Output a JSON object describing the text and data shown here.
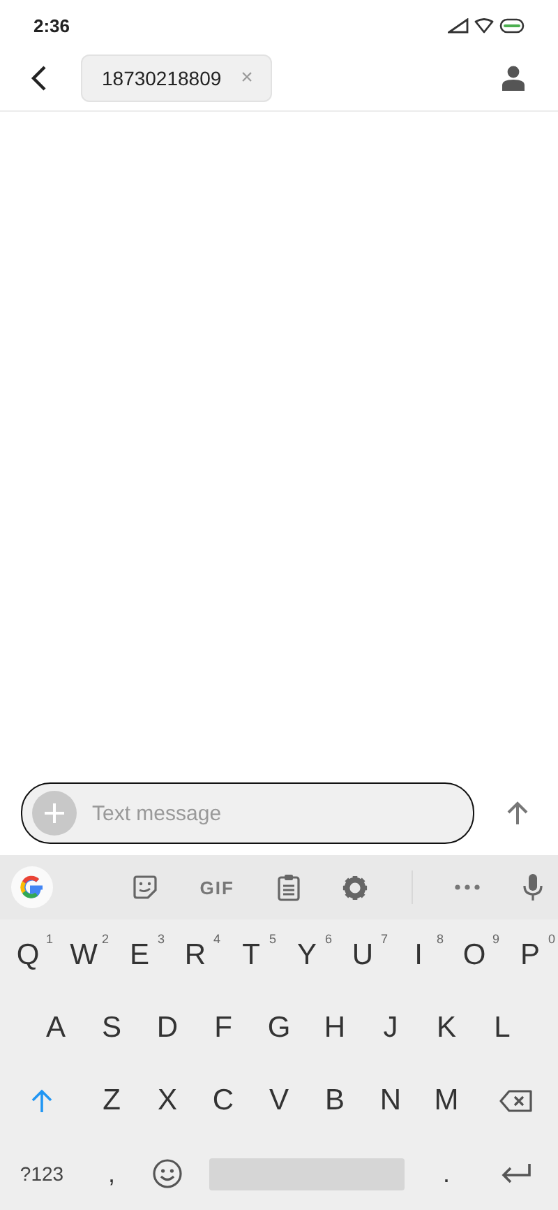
{
  "status_bar": {
    "time": "2:36"
  },
  "header": {
    "recipient": "18730218809",
    "remove": "×"
  },
  "composer": {
    "placeholder": "Text message"
  },
  "keyboard": {
    "toolbar": [
      {
        "kind": "google"
      },
      {
        "kind": "sticker"
      },
      {
        "kind": "gif",
        "label": "GIF"
      },
      {
        "kind": "clipboard"
      },
      {
        "kind": "settings"
      },
      {
        "kind": "more"
      },
      {
        "kind": "mic"
      }
    ],
    "rows": [
      {
        "keys": [
          {
            "kind": "letter",
            "label": "Q",
            "hint": "1"
          },
          {
            "kind": "letter",
            "label": "W",
            "hint": "2"
          },
          {
            "kind": "letter",
            "label": "E",
            "hint": "3"
          },
          {
            "kind": "letter",
            "label": "R",
            "hint": "4"
          },
          {
            "kind": "letter",
            "label": "T",
            "hint": "5"
          },
          {
            "kind": "letter",
            "label": "Y",
            "hint": "6"
          },
          {
            "kind": "letter",
            "label": "U",
            "hint": "7"
          },
          {
            "kind": "letter",
            "label": "I",
            "hint": "8"
          },
          {
            "kind": "letter",
            "label": "O",
            "hint": "9"
          },
          {
            "kind": "letter",
            "label": "P",
            "hint": "0"
          }
        ]
      },
      {
        "keys": [
          {
            "kind": "letter",
            "label": "A"
          },
          {
            "kind": "letter",
            "label": "S"
          },
          {
            "kind": "letter",
            "label": "D"
          },
          {
            "kind": "letter",
            "label": "F"
          },
          {
            "kind": "letter",
            "label": "G"
          },
          {
            "kind": "letter",
            "label": "H"
          },
          {
            "kind": "letter",
            "label": "J"
          },
          {
            "kind": "letter",
            "label": "K"
          },
          {
            "kind": "letter",
            "label": "L"
          }
        ]
      },
      {
        "keys": [
          {
            "kind": "shift"
          },
          {
            "kind": "letter",
            "label": "Z"
          },
          {
            "kind": "letter",
            "label": "X"
          },
          {
            "kind": "letter",
            "label": "C"
          },
          {
            "kind": "letter",
            "label": "V"
          },
          {
            "kind": "letter",
            "label": "B"
          },
          {
            "kind": "letter",
            "label": "N"
          },
          {
            "kind": "letter",
            "label": "M"
          },
          {
            "kind": "backspace"
          }
        ]
      },
      {
        "keys": [
          {
            "kind": "symbols",
            "label": "?123"
          },
          {
            "kind": "punct",
            "label": ","
          },
          {
            "kind": "emoji"
          },
          {
            "kind": "space"
          },
          {
            "kind": "punct",
            "label": "."
          },
          {
            "kind": "enter"
          }
        ]
      }
    ]
  }
}
